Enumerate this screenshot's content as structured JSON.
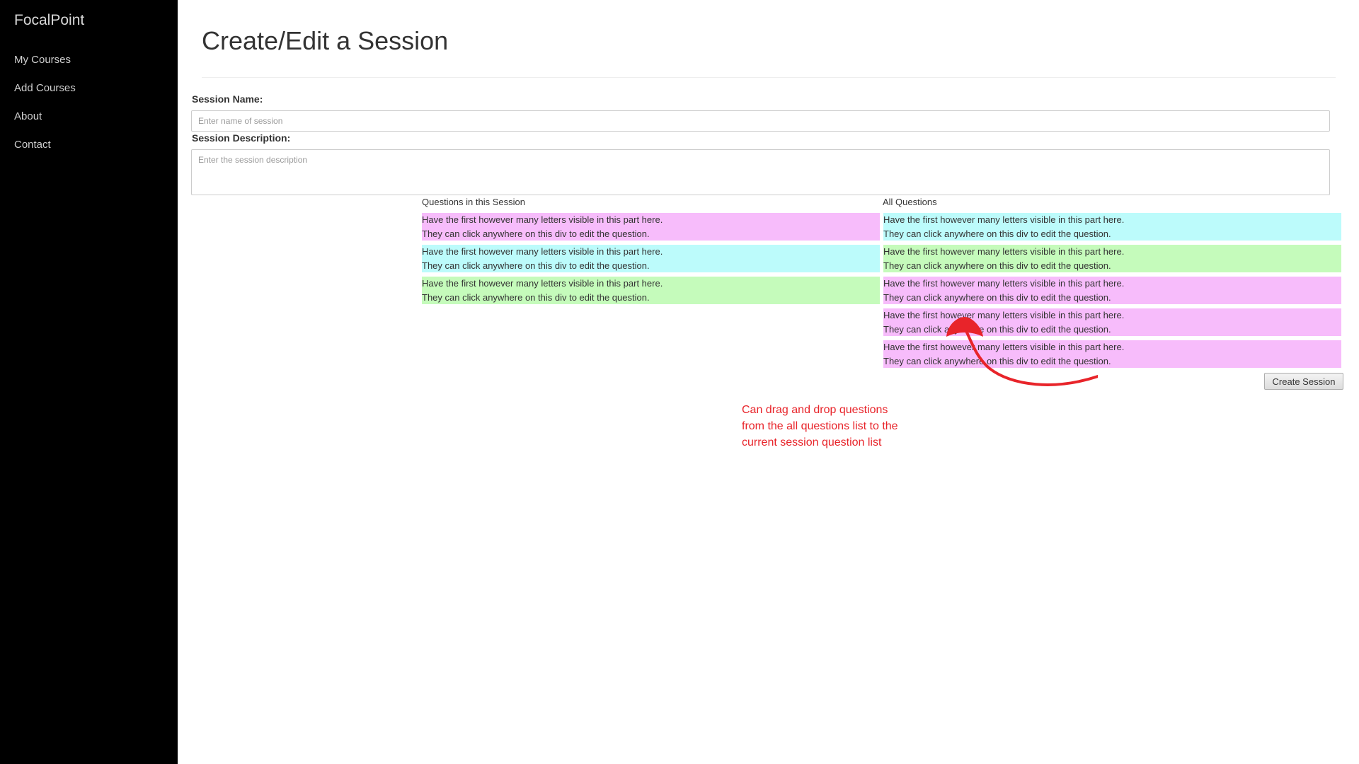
{
  "sidebar": {
    "brand": "FocalPoint",
    "items": [
      {
        "label": "My Courses"
      },
      {
        "label": "Add Courses"
      },
      {
        "label": "About"
      },
      {
        "label": "Contact"
      }
    ]
  },
  "page": {
    "title": "Create/Edit a Session"
  },
  "form": {
    "name_label": "Session Name:",
    "name_placeholder": "Enter name of session",
    "name_value": "",
    "desc_label": "Session Description:",
    "desc_placeholder": "Enter the session description",
    "desc_value": "",
    "submit_label": "Create Session"
  },
  "questions": {
    "session_heading": "Questions in this Session",
    "all_heading": "All Questions",
    "session_list": [
      {
        "line1": "Have the first however many letters visible in this part here.",
        "line2": "They can click anywhere on this div to edit the question.",
        "color": "#f7bcfb"
      },
      {
        "line1": "Have the first however many letters visible in this part here.",
        "line2": "They can click anywhere on this div to edit the question.",
        "color": "#bcfbfb"
      },
      {
        "line1": "Have the first however many letters visible in this part here.",
        "line2": "They can click anywhere on this div to edit the question.",
        "color": "#c5fbbb"
      }
    ],
    "all_list": [
      {
        "line1": "Have the first however many letters visible in this part here.",
        "line2": "They can click anywhere on this div to edit the question.",
        "color": "#bcfbfb"
      },
      {
        "line1": "Have the first however many letters visible in this part here.",
        "line2": "They can click anywhere on this div to edit the question.",
        "color": "#c5fbbb"
      },
      {
        "line1": "Have the first however many letters visible in this part here.",
        "line2": "They can click anywhere on this div to edit the question.",
        "color": "#f7bcfb"
      },
      {
        "line1": "Have the first however many letters visible in this part here.",
        "line2": "They can click anywhere on this div to edit the question.",
        "color": "#f7bcfb"
      },
      {
        "line1": "Have the first however many letters visible in this part here.",
        "line2": "They can click anywhere on this div to edit the question.",
        "color": "#f7bcfb"
      }
    ]
  },
  "annotation": {
    "lines": [
      "Can drag and drop questions",
      "from the all questions list to the",
      "current session question list"
    ],
    "color": "#e8242a"
  }
}
